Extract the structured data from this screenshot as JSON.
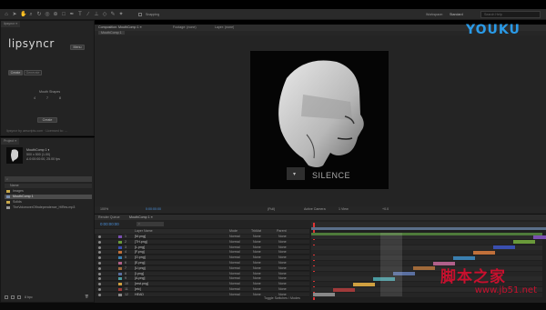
{
  "toolbar": {
    "snapping_label": "Snapping",
    "workspace_label": "Workspace:",
    "workspace_value": "Standard",
    "search_placeholder": "Search Help"
  },
  "lipsyncr": {
    "tab_label": "lipsyncr ≡",
    "title": "lipsyncr",
    "menu_button": "Menu",
    "tab_create": "Create",
    "tab_generate": "Generate",
    "mouth_shapes_label": "Mouth Shapes",
    "mouth_shapes_values": [
      "4",
      "7",
      "8"
    ],
    "create_button": "Create",
    "footer_text": "lipsyncr by aescripts.com · Licensed to: ..."
  },
  "project": {
    "tab_label": "Project ≡",
    "comp_name": "MouthComp 1 ▾",
    "comp_info1": "500 x 500 (1.00)",
    "comp_info2": "Δ 0:00:00:00, 25.00 fps",
    "search_placeholder": "⌕",
    "items": [
      "Name",
      "Images",
      "MouthComp 1",
      "Solids",
      "TheVoiceoverOfIndependence_HiRes.mp3"
    ],
    "bpc_label": "8 bpc"
  },
  "viewer": {
    "tab_comp": "Composition: MouthComp 1 ≡",
    "tab_footage": "Footage: (none)",
    "tab_layer": "Layer: (none)",
    "subtab": "MouthComp 1",
    "mouth_label": "SILENCE",
    "zoom": "100%",
    "timecode": "0:00:00:00",
    "resolution": "(Full)",
    "camera": "Active Camera",
    "views": "1 View",
    "offset": "+0.0"
  },
  "timeline": {
    "tab_render": "Render Queue",
    "tab_comp": "MouthComp 1 ≡",
    "timecode": "0:00:00:00",
    "search_placeholder": "⌕",
    "col_layer_name": "Layer Name",
    "col_mode": "Mode",
    "col_trkmat": "TrkMat",
    "col_parent": "Parent",
    "layers": [
      {
        "num": "1",
        "name": "[M.png]",
        "mode": "Normal",
        "trkmat": "None",
        "parent": "None"
      },
      {
        "num": "2",
        "name": "[TH.png]",
        "mode": "Normal",
        "trkmat": "None",
        "parent": "None"
      },
      {
        "num": "3",
        "name": "[L.png]",
        "mode": "Normal",
        "trkmat": "None",
        "parent": "None"
      },
      {
        "num": "4",
        "name": "[F.png]",
        "mode": "Normal",
        "trkmat": "None",
        "parent": "None"
      },
      {
        "num": "5",
        "name": "[O.png]",
        "mode": "Normal",
        "trkmat": "None",
        "parent": "None"
      },
      {
        "num": "6",
        "name": "[E.png]",
        "mode": "Normal",
        "trkmat": "None",
        "parent": "None"
      },
      {
        "num": "7",
        "name": "[U.png]",
        "mode": "Normal",
        "trkmat": "None",
        "parent": "None"
      },
      {
        "num": "8",
        "name": "[I.png]",
        "mode": "Normal",
        "trkmat": "None",
        "parent": "None"
      },
      {
        "num": "9",
        "name": "[A.png]",
        "mode": "Normal",
        "trkmat": "None",
        "parent": "None"
      },
      {
        "num": "10",
        "name": "[rest.png]",
        "mode": "Normal",
        "trkmat": "None",
        "parent": "None"
      },
      {
        "num": "11",
        "name": "[etc]",
        "mode": "Normal",
        "trkmat": "None",
        "parent": "None"
      },
      {
        "num": "12",
        "name": "HEAD",
        "mode": "Normal",
        "trkmat": "None",
        "parent": "None"
      }
    ],
    "toggle_label": "Toggle Switches / Modes"
  },
  "watermarks": {
    "brand": "YOUKU",
    "bottom_cn": "脚本之家",
    "bottom_url": "www.jb51.net"
  },
  "colors": {
    "youku_blue": "#2a9be8",
    "youku_red": "#e8432a",
    "bottom_wm_red": "#c8102e",
    "accent_blue": "#4a8fd9"
  }
}
